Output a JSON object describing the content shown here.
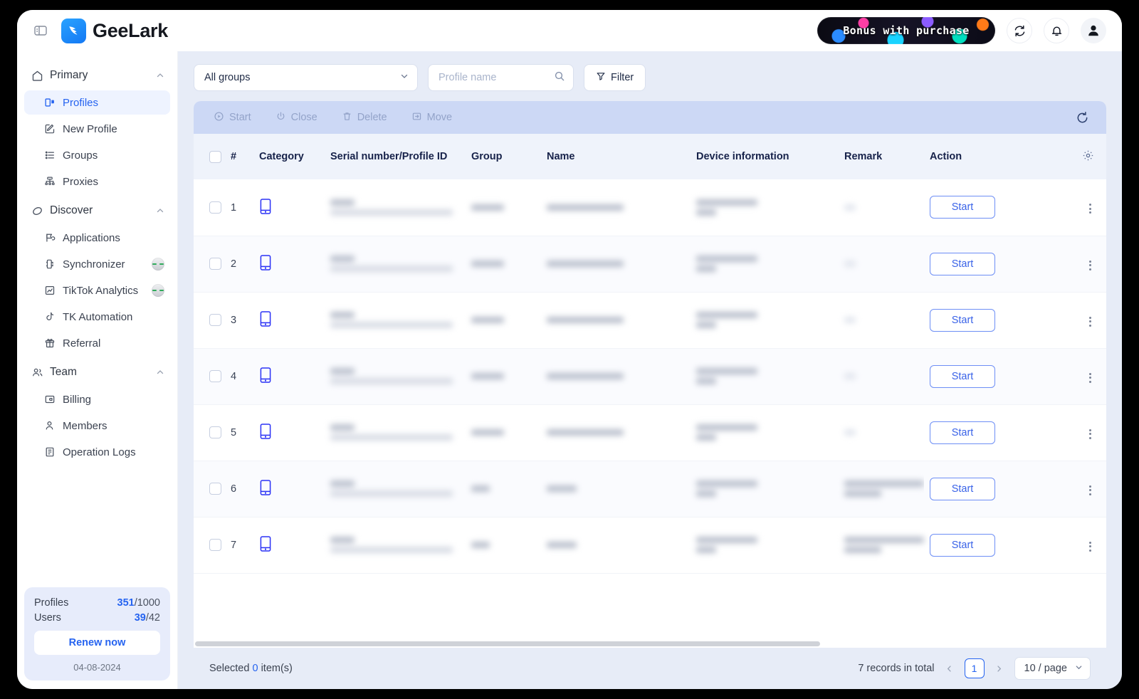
{
  "app": {
    "brand": "GeeLark",
    "promo_banner": "Bonus with purchase"
  },
  "topbar": {
    "panel_toggle_icon": "panel-toggle-icon",
    "refresh_icon": "refresh-icon",
    "notification_icon": "bell-icon",
    "account_icon": "user-avatar-icon"
  },
  "sidebar": {
    "groups": [
      {
        "label": "Primary",
        "icon": "home-icon",
        "expanded": true,
        "items": [
          {
            "label": "Profiles",
            "icon": "profiles-icon",
            "active": true,
            "badge": false
          },
          {
            "label": "New Profile",
            "icon": "edit-square-icon",
            "active": false,
            "badge": false
          },
          {
            "label": "Groups",
            "icon": "list-icon",
            "active": false,
            "badge": false
          },
          {
            "label": "Proxies",
            "icon": "network-icon",
            "active": false,
            "badge": false
          }
        ]
      },
      {
        "label": "Discover",
        "icon": "discover-icon",
        "expanded": true,
        "items": [
          {
            "label": "Applications",
            "icon": "applications-icon",
            "active": false,
            "badge": false
          },
          {
            "label": "Synchronizer",
            "icon": "synchronizer-icon",
            "active": false,
            "badge": true
          },
          {
            "label": "TikTok Analytics",
            "icon": "analytics-chart-icon",
            "active": false,
            "badge": true
          },
          {
            "label": "TK Automation",
            "icon": "tiktok-note-icon",
            "active": false,
            "badge": false
          },
          {
            "label": "Referral",
            "icon": "gift-icon",
            "active": false,
            "badge": false
          }
        ]
      },
      {
        "label": "Team",
        "icon": "team-people-icon",
        "expanded": true,
        "items": [
          {
            "label": "Billing",
            "icon": "billing-card-icon",
            "active": false,
            "badge": false
          },
          {
            "label": "Members",
            "icon": "member-person-icon",
            "active": false,
            "badge": false
          },
          {
            "label": "Operation Logs",
            "icon": "document-log-icon",
            "active": false,
            "badge": false
          }
        ]
      }
    ],
    "plan_card": {
      "profiles_label": "Profiles",
      "profiles_used": "351",
      "profiles_total": "/1000",
      "users_label": "Users",
      "users_used": "39",
      "users_total": "/42",
      "renew_label": "Renew now",
      "expiry_date": "04-08-2024"
    }
  },
  "toolbar": {
    "group_select_value": "All groups",
    "group_select_icon": "chevron-down-icon",
    "search_placeholder": "Profile name",
    "search_value": "",
    "search_icon": "search-icon",
    "filter_label": "Filter",
    "filter_icon": "filter-icon"
  },
  "bulk_actions": {
    "items": [
      {
        "label": "Start",
        "icon": "play-circle-icon"
      },
      {
        "label": "Close",
        "icon": "power-icon"
      },
      {
        "label": "Delete",
        "icon": "trash-icon"
      },
      {
        "label": "Move",
        "icon": "move-box-icon"
      }
    ],
    "refresh_icon": "refresh-spinner-icon",
    "disabled": true
  },
  "table": {
    "columns": [
      {
        "key": "checkbox",
        "label": ""
      },
      {
        "key": "index",
        "label": "#"
      },
      {
        "key": "category",
        "label": "Category"
      },
      {
        "key": "serial",
        "label": "Serial number/Profile ID"
      },
      {
        "key": "group",
        "label": "Group"
      },
      {
        "key": "name",
        "label": "Name"
      },
      {
        "key": "device",
        "label": "Device information"
      },
      {
        "key": "remark",
        "label": "Remark"
      },
      {
        "key": "action",
        "label": "Action"
      }
    ],
    "settings_icon": "gear-icon",
    "row_action_label": "Start",
    "row_kebab_icon": "more-vertical-icon",
    "category_icon": "mobile-phone-icon",
    "rows": [
      {
        "index": "1",
        "redacted": true,
        "remark_long": false
      },
      {
        "index": "2",
        "redacted": true,
        "remark_long": false
      },
      {
        "index": "3",
        "redacted": true,
        "remark_long": false
      },
      {
        "index": "4",
        "redacted": true,
        "remark_long": false
      },
      {
        "index": "5",
        "redacted": true,
        "remark_long": false
      },
      {
        "index": "6",
        "redacted": true,
        "remark_long": true
      },
      {
        "index": "7",
        "redacted": true,
        "remark_long": true
      }
    ]
  },
  "footer": {
    "selected_prefix": "Selected ",
    "selected_count": "0",
    "selected_suffix": " item(s)",
    "records_total": "7 records in total",
    "prev_icon": "chevron-left-icon",
    "next_icon": "chevron-right-icon",
    "current_page": "1",
    "page_size": "10 / page",
    "page_size_icon": "chevron-down-icon"
  }
}
